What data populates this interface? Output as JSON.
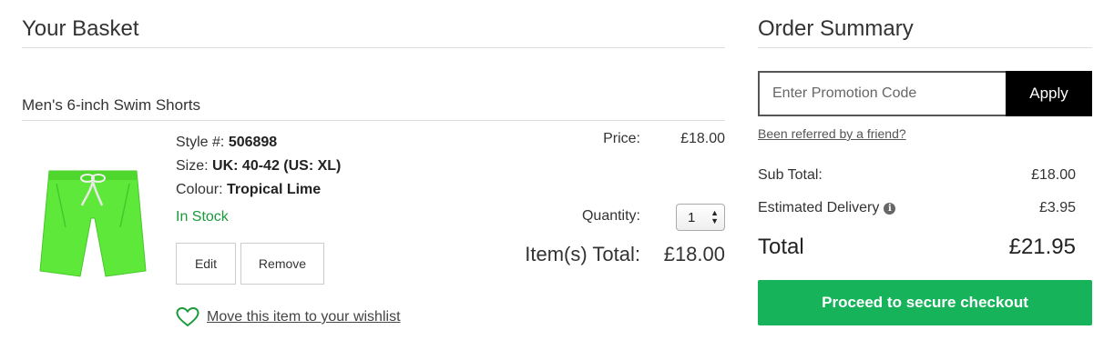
{
  "basket": {
    "title": "Your Basket",
    "item": {
      "name": "Men's 6-inch Swim Shorts",
      "style_label": "Style #:",
      "style_value": "506898",
      "size_label": "Size:",
      "size_value": "UK: 40-42 (US: XL)",
      "colour_label": "Colour:",
      "colour_value": "Tropical Lime",
      "stock_status": "In Stock",
      "edit_label": "Edit",
      "remove_label": "Remove",
      "wishlist_label": "Move this item to your wishlist",
      "price_label": "Price:",
      "price_value": "£18.00",
      "quantity_label": "Quantity:",
      "quantity_value": "1",
      "items_total_label": "Item(s) Total:",
      "items_total_value": "£18.00",
      "image_icon": "swim-shorts-image"
    }
  },
  "summary": {
    "title": "Order Summary",
    "promo_placeholder": "Enter Promotion Code",
    "apply_label": "Apply",
    "referred_link": "Been referred by a friend?",
    "subtotal_label": "Sub Total:",
    "subtotal_value": "£18.00",
    "delivery_label": "Estimated Delivery",
    "delivery_value": "£3.95",
    "total_label": "Total",
    "total_value": "£21.95",
    "checkout_label": "Proceed to secure checkout"
  },
  "colors": {
    "accent_green": "#17b35a",
    "stock_green": "#1a9a3a",
    "apply_black": "#000000",
    "shorts_lime": "#5ee83a"
  }
}
